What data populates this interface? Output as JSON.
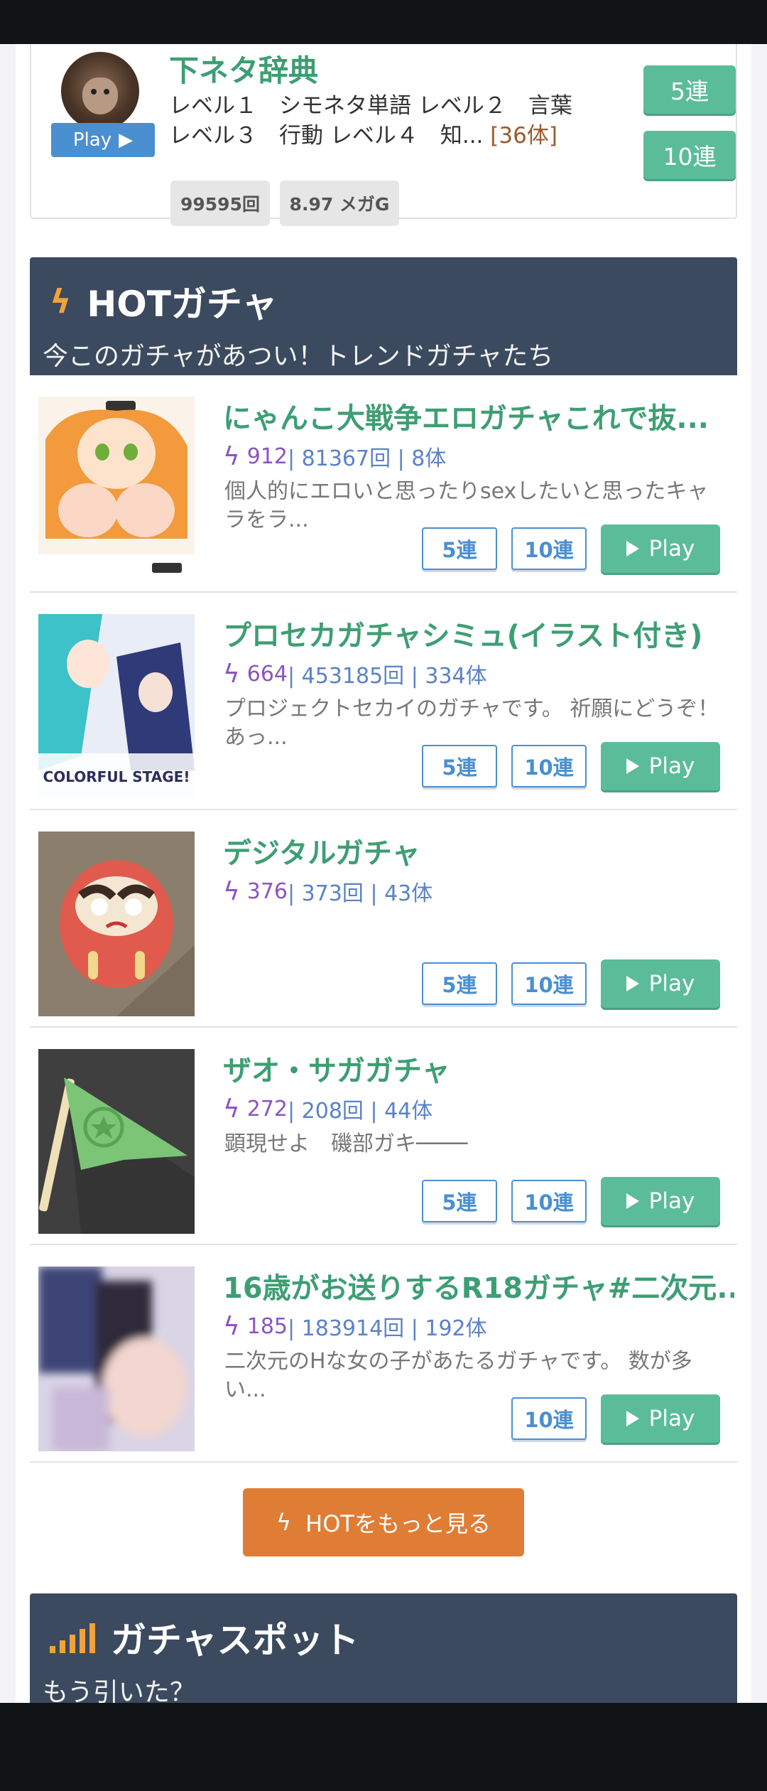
{
  "top_card": {
    "title": "下ネタ辞典",
    "play_label": "Play",
    "desc_line1": "レベル１　シモネタ単語 レベル２　言葉",
    "desc_line2": "レベル３　行動 レベル４　知...",
    "count": "[36体]",
    "plays_tag": "99595回",
    "size_tag": "8.97 メガG",
    "btn5": "5連",
    "btn10": "10連"
  },
  "hot_section": {
    "title": "HOTガチャ",
    "subtitle": "今このガチャがあつい！トレンドガチャたち"
  },
  "rows": [
    {
      "title": "にゃんこ大戦争エロガチャこれで抜...",
      "hot": "912",
      "rest": " | 81367回 | 8体",
      "desc": "個人的にエロいと思ったりsexしたいと思ったキャラをラ...",
      "has5": true
    },
    {
      "title": "プロセカガチャシミュ(イラスト付き)",
      "hot": "664",
      "rest": " | 453185回 | 334体",
      "desc": "プロジェクトセカイのガチャです。 祈願にどうぞ！あっ...",
      "has5": true
    },
    {
      "title": "デジタルガチャ",
      "hot": "376",
      "rest": " | 373回 | 43体",
      "desc": "",
      "has5": true
    },
    {
      "title": "ザオ・サガガチャ",
      "hot": "272",
      "rest": " | 208回 | 44体",
      "desc": "顕現せよ　磯部ガキ────",
      "has5": true
    },
    {
      "title": "16歳がお送りするR18ガチャ#二次元...",
      "hot": "185",
      "rest": " | 183914回 | 192体",
      "desc": "二次元のHな女の子があたるガチャです。 数が多い...",
      "has5": false
    }
  ],
  "buttons": {
    "five": "5連",
    "ten": "10連",
    "play": "Play"
  },
  "more_button": "HOTをもっと見る",
  "spot_section": {
    "title": "ガチャスポット",
    "subtitle": "もう引いた？"
  },
  "colors": {
    "accent_green": "#5bbc9a",
    "title_green": "#3e9e73",
    "header_navy": "#3b4a5e",
    "orange": "#e07d35",
    "purple": "#8c54c2",
    "blue": "#4a8fd0"
  },
  "icons": {
    "hot": "bolt-icon",
    "spot": "signal-bars-icon",
    "play": "play-triangle-icon"
  }
}
